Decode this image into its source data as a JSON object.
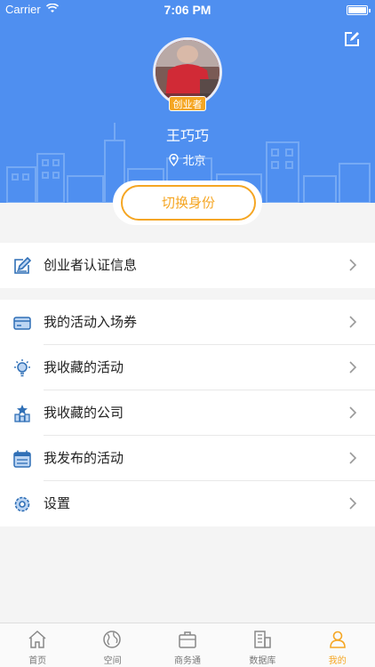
{
  "status_bar": {
    "carrier": "Carrier",
    "time": "7:06 PM"
  },
  "profile": {
    "badge": "创业者",
    "name": "王巧巧",
    "location": "北京",
    "switch_label": "切换身份"
  },
  "cert_section": {
    "items": [
      {
        "label": "创业者认证信息",
        "icon": "edit-icon"
      }
    ]
  },
  "menu_section": {
    "items": [
      {
        "label": "我的活动入场券",
        "icon": "ticket-icon"
      },
      {
        "label": "我收藏的活动",
        "icon": "lightbulb-icon"
      },
      {
        "label": "我收藏的公司",
        "icon": "company-icon"
      },
      {
        "label": "我发布的活动",
        "icon": "calendar-icon"
      },
      {
        "label": "设置",
        "icon": "settings-icon"
      }
    ]
  },
  "tabbar": {
    "tabs": [
      {
        "label": "首页",
        "icon": "home-icon"
      },
      {
        "label": "空间",
        "icon": "globe-icon"
      },
      {
        "label": "商务通",
        "icon": "briefcase-icon"
      },
      {
        "label": "数据库",
        "icon": "building-icon"
      },
      {
        "label": "我的",
        "icon": "user-icon"
      }
    ],
    "active_index": 4
  },
  "colors": {
    "header": "#4f8ff0",
    "accent": "#f5a623",
    "icon_blue": "#2f6fb6"
  }
}
